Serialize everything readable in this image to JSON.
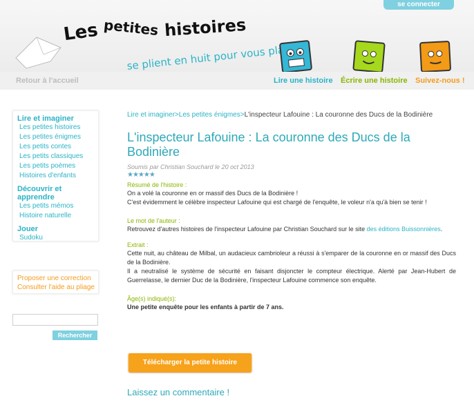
{
  "header": {
    "login_label": "se connecter",
    "logo_text": "Les petites histoires",
    "tagline": "se plient en huit pour vous plaire"
  },
  "nav": {
    "home": "Retour à l'accueil",
    "read": "Lire une histoire",
    "write": "Écrire une histoire",
    "follow": "Suivez-nous !"
  },
  "sidebar": {
    "section1": {
      "title": "Lire et imaginer",
      "items": [
        "Les petites histoires",
        "Les petites énigmes",
        "Les petits contes",
        "Les petits classiques",
        "Les petits poèmes",
        "Histoires d'enfants"
      ]
    },
    "section2": {
      "title": "Découvrir et apprendre",
      "items": [
        "Les petits mémos",
        "Histoire naturelle"
      ]
    },
    "section3": {
      "title": "Jouer",
      "items": [
        "Sudoku"
      ]
    },
    "extra": [
      "Proposer une correction",
      "Consulter l'aide au pliage"
    ],
    "search_button": "Rechercher",
    "search_placeholder": ""
  },
  "main": {
    "breadcrumb": [
      "Lire et imaginer",
      "Les petites énigmes",
      "L'inspecteur Lafouine : La couronne des Ducs de la Bodinière"
    ],
    "breadcrumb_sep": ">",
    "title": "L'inspecteur Lafouine : La couronne des Ducs de la Bodinière",
    "meta": "Soumis par Christian Souchard le 20 oct 2013",
    "stars": "★★★★★",
    "rating": 5,
    "summary_label": "Résumé de l'histoire :",
    "summary_1": "On a volé la couronne en or massif des Ducs de la Bodinière !",
    "summary_2": "C'est évidemment le célèbre inspecteur Lafouine qui est chargé de l'enquête, le voleur n'a qu'à bien se tenir !",
    "author_label": "Le mot de l'auteur :",
    "author_text": "Retrouvez d'autres histoires de l'inspecteur Lafouine par Christian Souchard sur le site",
    "author_link": "des éditions Buissonnières",
    "author_end": ".",
    "extract_label": "Extrait :",
    "extract_1": "Cette nuit, au château de Milbal, un audacieux cambrioleur a réussi à s'emparer de la couronne en or massif des Ducs de la Bodinière.",
    "extract_2": "Il a neutralisé le système de sécurité en faisant disjoncter le compteur électrique. Alerté par Jean-Hubert de Guerrelasse, le dernier Duc de la Bodinière, l'inspecteur Lafouine commence son enquête.",
    "age_label": "Âge(s) indiqué(s):",
    "age_text": "Une petite enquête pour les enfants à partir de 7 ans.",
    "download_label": "Télécharger la petite histoire",
    "comment_heading": "Laissez un commentaire !"
  },
  "colors": {
    "accent": "#2bb3c6",
    "orange": "#f39c1f",
    "green": "#8ab500"
  }
}
